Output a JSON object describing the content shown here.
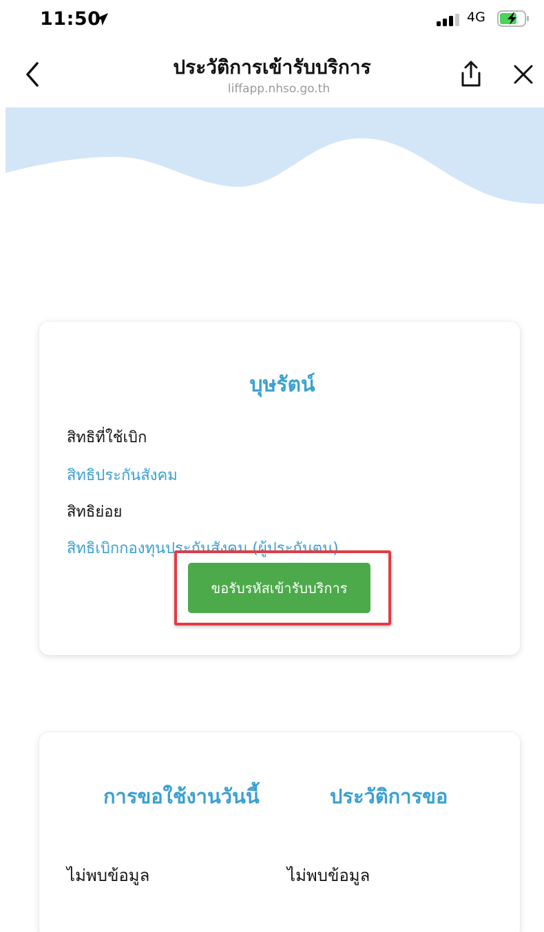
{
  "status_bar": {
    "time": "11:50",
    "network": "4G",
    "icons": [
      "location-arrow-icon",
      "signal-bars-icon",
      "battery-charging-icon"
    ]
  },
  "nav": {
    "title": "ประวัติการเข้ารับบริการ",
    "url": "liffapp.nhso.go.th",
    "icons": [
      "chevron-left-icon",
      "share-icon",
      "close-icon"
    ]
  },
  "colors": {
    "accent": "#3aa0d0",
    "wave": "#d3e6f8",
    "button": "#4caa4a",
    "highlight": "#e23c44"
  },
  "rights_card": {
    "title": "บุษรัตน์",
    "claim_label": "สิทธิที่ใช้เบิก",
    "claim_value": "สิทธิประกันสังคม",
    "sub_label": "สิทธิย่อย",
    "sub_value": "สิทธิเบิกกองทุนประกันสังคม (ผู้ประกันตน)",
    "button_label": "ขอรับรหัสเข้ารับบริการ"
  },
  "requests_card": {
    "today_label": "การขอใช้งานวันนี้",
    "history_label": "ประวัติการขอ",
    "today_empty": "ไม่พบข้อมูล",
    "history_empty": "ไม่พบข้อมูล"
  }
}
